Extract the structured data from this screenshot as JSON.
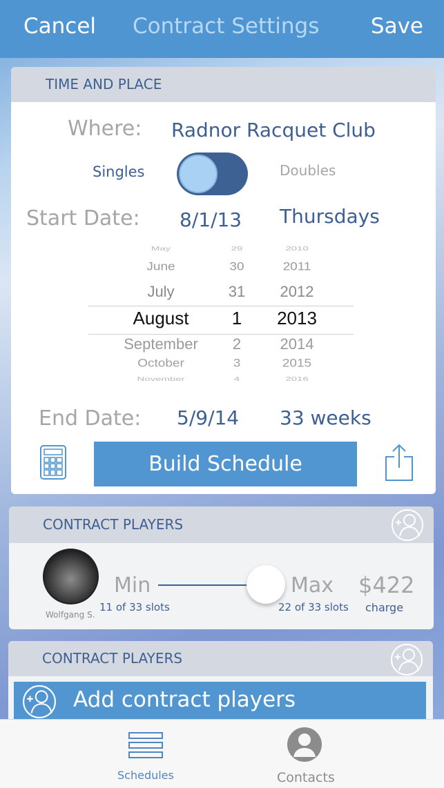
{
  "header": {
    "cancel_label": "Cancel",
    "title": "Contract Settings",
    "save_label": "Save",
    "background": "#4f95d2"
  },
  "time_place": {
    "section_title": "TIME AND PLACE",
    "where_label": "Where:",
    "where_value": "Radnor Racquet Club",
    "toggle_left_label": "Singles",
    "toggle_right_label": "Doubles",
    "toggle_state": "singles",
    "start_label": "Start Date:",
    "start_value": "8/1/13",
    "start_day": "Thursdays",
    "date_picker": {
      "months": [
        "May",
        "June",
        "July",
        "August",
        "September",
        "October",
        "November"
      ],
      "days": [
        "29",
        "30",
        "31",
        "1",
        "2",
        "3",
        "4"
      ],
      "years": [
        "2010",
        "2011",
        "2012",
        "2013",
        "2014",
        "2015",
        "2016"
      ],
      "selected": {
        "month": "August",
        "day": "1",
        "year": "2013"
      }
    },
    "end_label": "End Date:",
    "end_value": "5/9/14",
    "end_weeks": "33 weeks",
    "build_label": "Build Schedule"
  },
  "contract_players": {
    "section_title": "CONTRACT PLAYERS",
    "player_name": "Wolfgang S.",
    "min_label": "Min",
    "min_sub": "11 of 33  slots",
    "max_label": "Max",
    "max_sub": "22 of 33 slots",
    "price": "$422",
    "price_sub": "charge"
  },
  "contract_players_2": {
    "section_title": "CONTRACT PLAYERS",
    "add_label": "Add contract players"
  },
  "tabbar": {
    "schedules_label": "Schedules",
    "contacts_label": "Contacts",
    "active_tab": "schedules"
  },
  "colors": {
    "accent_blue": "#5196d1",
    "dark_blue_text": "#3d5f92",
    "gray_text": "#a6a6a6"
  }
}
